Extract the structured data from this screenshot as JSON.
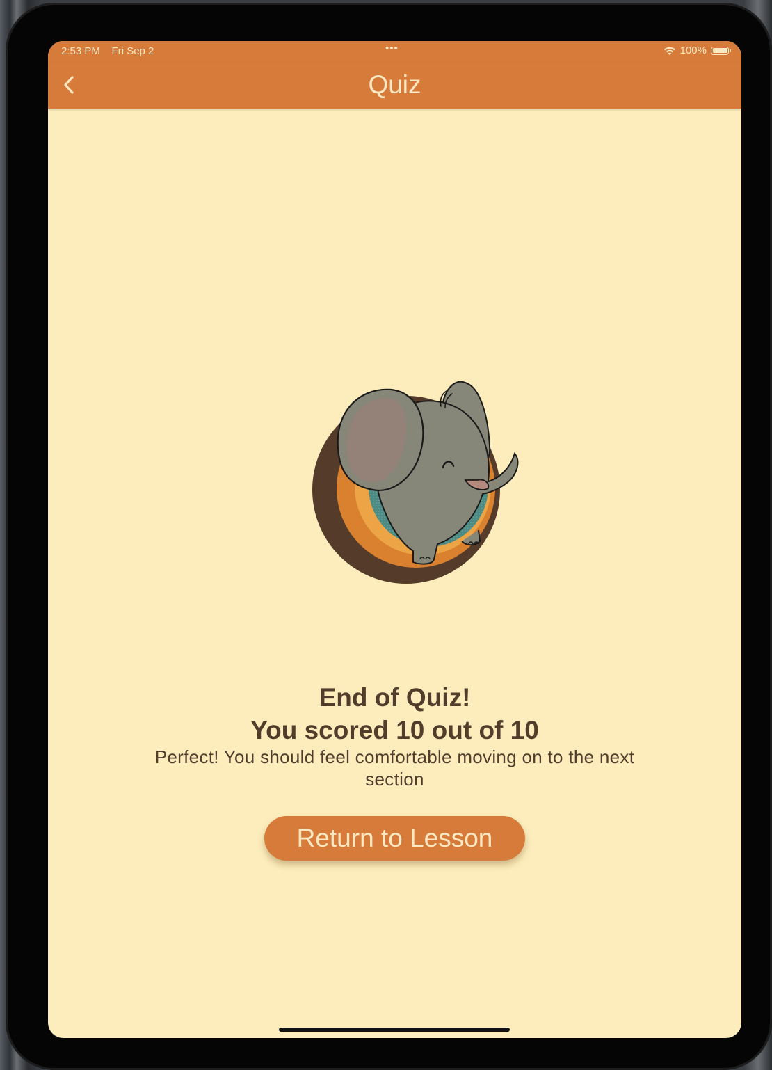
{
  "status_bar": {
    "time": "2:53 PM",
    "date": "Fri Sep 2",
    "dots": "•••",
    "battery_percent": "100%",
    "wifi_icon": "wifi-icon",
    "battery_icon": "battery-icon"
  },
  "nav": {
    "title": "Quiz",
    "back_icon": "chevron-left-icon"
  },
  "result": {
    "title_line1": "End of Quiz!",
    "title_line2": "You scored 10 out of 10",
    "message": "Perfect! You should feel comfortable moving on to the next section",
    "score": 10,
    "total": 10
  },
  "actions": {
    "return_label": "Return to Lesson"
  },
  "colors": {
    "accent": "#d67b39",
    "background": "#fdedbd",
    "text": "#523c2b",
    "light_text": "#fde8c3"
  }
}
